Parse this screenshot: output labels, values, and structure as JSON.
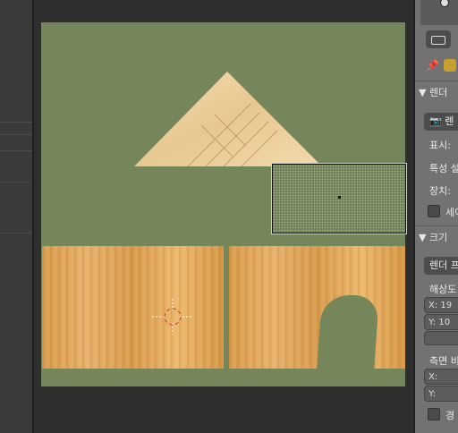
{
  "properties_panel": {
    "section_render": "▼ 렌더",
    "render_button": "렌",
    "display_label": "표시:",
    "feature_label": "특성 설",
    "device_label": "장치:",
    "shade_label": "세이",
    "section_size": "▼ 크기",
    "render_preset": "렌더 프",
    "resolution_label": "해상도",
    "res_x": "X: 19",
    "res_y": "Y: 10",
    "aspect_label": "측면 비",
    "aspect_x": "X:",
    "aspect_y": "Y:",
    "border_label": "경"
  },
  "colors": {
    "camera_background": "#75865a",
    "panel_background": "#727272",
    "editor_background": "#2e2e2e"
  },
  "icons": [
    "pin-icon",
    "render-camera-icon",
    "toggle-icon",
    "texture-icon",
    "crosshair-cursor-icon"
  ]
}
